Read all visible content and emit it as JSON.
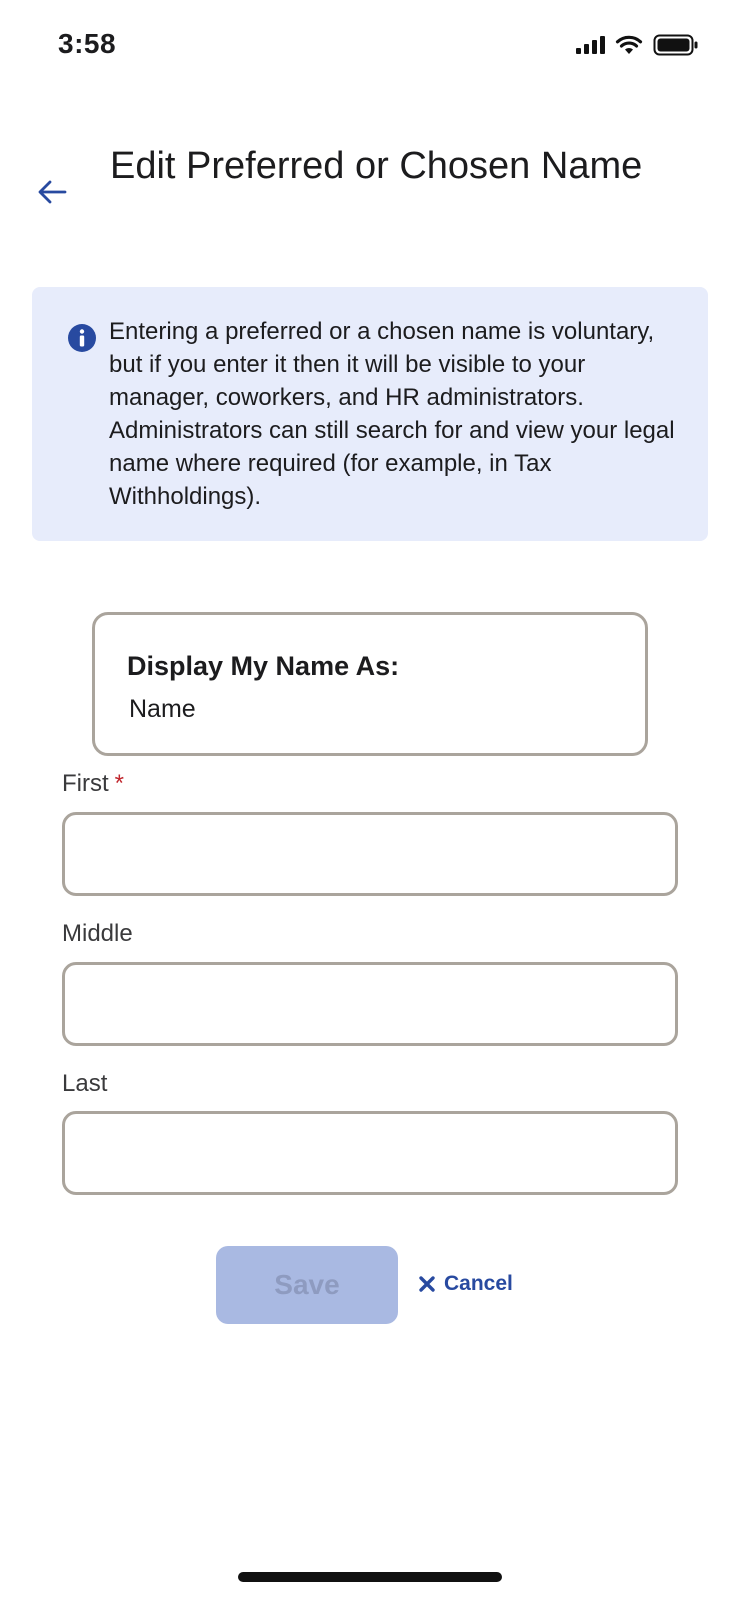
{
  "status_bar": {
    "time": "3:58",
    "icons": [
      "signal-icon",
      "wifi-icon",
      "battery-icon"
    ]
  },
  "header": {
    "back_icon": "arrow-left-icon",
    "title": "Edit Preferred or Chosen Name"
  },
  "info_box": {
    "icon": "info-icon",
    "text": "Entering a preferred or a chosen name is voluntary, but if you enter it then it will be visible to your manager, coworkers, and HR administrators. Administrators can still search for and view your legal name where required (for example, in Tax Withholdings)."
  },
  "display_card": {
    "label": "Display My Name As:",
    "value": "Name"
  },
  "form": {
    "first": {
      "label": "First",
      "required_mark": "*",
      "value": ""
    },
    "middle": {
      "label": "Middle",
      "value": ""
    },
    "last": {
      "label": "Last",
      "value": ""
    }
  },
  "actions": {
    "save_label": "Save",
    "cancel_label": "Cancel",
    "cancel_icon": "close-icon"
  },
  "colors": {
    "accent": "#284aa0",
    "info_background": "#e7ecfb",
    "save_disabled": "#a9b9e2",
    "field_border": "#aaa49c",
    "required": "#c0262d"
  }
}
